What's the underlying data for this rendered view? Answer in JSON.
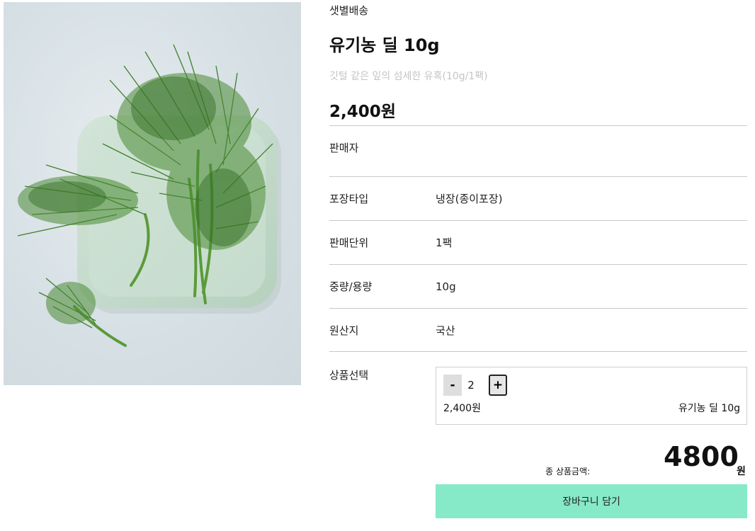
{
  "product": {
    "delivery_type": "샛별배송",
    "title": "유기농 딜 10g",
    "subtitle": "깃털 같은 잎의 섬세한 유혹(10g/1팩)",
    "price": "2,400원"
  },
  "details": [
    {
      "label": "판매자",
      "value": ""
    },
    {
      "label": "포장타입",
      "value": "냉장(종이포장)"
    },
    {
      "label": "판매단위",
      "value": "1팩"
    },
    {
      "label": "중량/용량",
      "value": "10g"
    },
    {
      "label": "원산지",
      "value": "국산"
    }
  ],
  "selection": {
    "label": "상품선택",
    "minus": "-",
    "plus": "+",
    "quantity": "2",
    "option_price": "2,400원",
    "option_name": "유기농 딜 10g"
  },
  "total": {
    "label": "종 상품금액:",
    "amount": "4800",
    "unit": "원"
  },
  "cart_button": "장바구니 담기",
  "colors": {
    "accent": "#86e9c8",
    "muted_text": "#c4c4c4"
  }
}
